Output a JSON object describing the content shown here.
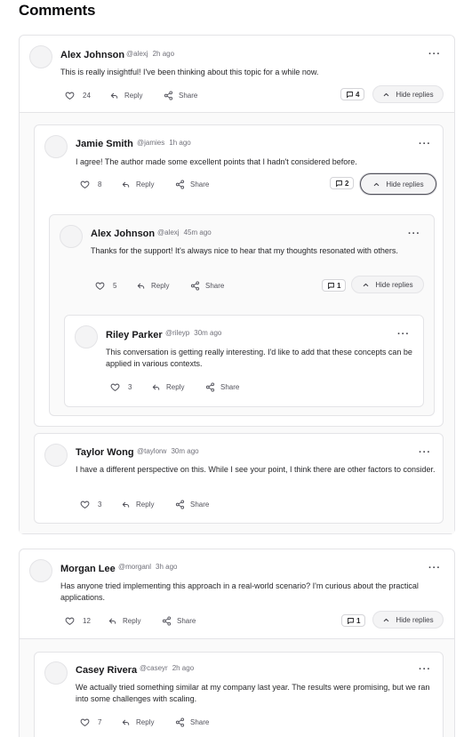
{
  "page_title": "Comments",
  "comments": [
    {
      "author": "Alex Johnson",
      "handle": "@alexj",
      "time": "2h ago",
      "text": "This is really insightful! I've been thinking about this topic for a while now.",
      "likes": "24",
      "reply_label": "Reply",
      "share_label": "Share",
      "reply_count": "4",
      "hide_label": "Hide replies",
      "replies": [
        {
          "author": "Jamie Smith",
          "handle": "@jamies",
          "time": "1h ago",
          "text": "I agree! The author made some excellent points that I hadn't considered before.",
          "likes": "8",
          "reply_label": "Reply",
          "share_label": "Share",
          "reply_count": "2",
          "hide_label": "Hide replies",
          "replies": [
            {
              "author": "Alex Johnson",
              "handle": "@alexj",
              "time": "45m ago",
              "text": "Thanks for the support! It's always nice to hear that my thoughts resonated with others.",
              "likes": "5",
              "reply_label": "Reply",
              "share_label": "Share",
              "reply_count": "1",
              "hide_label": "Hide replies",
              "replies": [
                {
                  "author": "Riley Parker",
                  "handle": "@rileyp",
                  "time": "30m ago",
                  "text": "This conversation is getting really interesting. I'd like to add that these concepts can be applied in various contexts.",
                  "likes": "3",
                  "reply_label": "Reply",
                  "share_label": "Share"
                }
              ]
            }
          ]
        },
        {
          "author": "Taylor Wong",
          "handle": "@taylorw",
          "time": "30m ago",
          "text": "I have a different perspective on this. While I see your point, I think there are other factors to consider.",
          "likes": "3",
          "reply_label": "Reply",
          "share_label": "Share"
        }
      ]
    },
    {
      "author": "Morgan Lee",
      "handle": "@morganl",
      "time": "3h ago",
      "text": "Has anyone tried implementing this approach in a real-world scenario? I'm curious about the practical applications.",
      "likes": "12",
      "reply_label": "Reply",
      "share_label": "Share",
      "reply_count": "1",
      "hide_label": "Hide replies",
      "replies": [
        {
          "author": "Casey Rivera",
          "handle": "@caseyr",
          "time": "2h ago",
          "text": "We actually tried something similar at my company last year. The results were promising, but we ran into some challenges with scaling.",
          "likes": "7",
          "reply_label": "Reply",
          "share_label": "Share"
        }
      ]
    }
  ],
  "icons": {
    "like": "heart-icon",
    "reply": "reply-arrow-icon",
    "share": "share-icon",
    "replies": "message-square-icon",
    "collapse": "chevron-up-icon",
    "more": "more-horizontal-icon"
  }
}
